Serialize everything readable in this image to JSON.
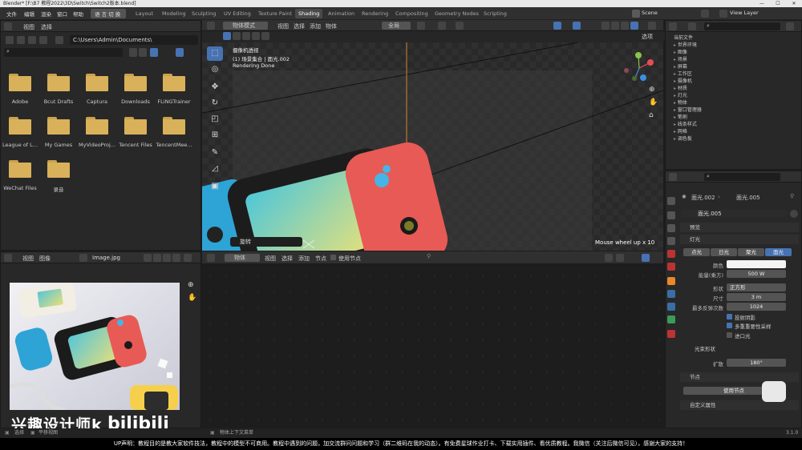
{
  "window": {
    "title": "Blender* [F:\\B7 教程2022\\3D\\Switch\\Switch2版本.blend]"
  },
  "menu": {
    "file": "文件",
    "edit": "编辑",
    "render": "渲染",
    "window": "窗口",
    "help": "帮助",
    "lang": "语 言 切 换"
  },
  "workspaces": [
    "Layout",
    "Modeling",
    "Sculpting",
    "UV Editing",
    "Texture Paint",
    "Shading",
    "Animation",
    "Rendering",
    "Compositing",
    "Geometry Nodes",
    "Scripting"
  ],
  "scene": {
    "label": "Scene",
    "view_layer": "View Layer"
  },
  "filebrowser": {
    "menu_view": "视图",
    "menu_select": "选择",
    "path": "C:\\Users\\Admin\\Documents\\",
    "items": [
      "Adobe",
      "Bcut Drafts",
      "Captura",
      "Downloads",
      "FLiNGTrainer",
      "League of L...",
      "My Games",
      "MyVideoProj...",
      "Tencent Files",
      "TencentMee...",
      "WeChat Files",
      "录音"
    ]
  },
  "viewport": {
    "mode": "物体模式",
    "view": "视图",
    "select": "选择",
    "add": "添加",
    "object": "物体",
    "global": "全局",
    "options": "选项",
    "camera_title": "摄像机透视",
    "collection": "(1) 场景集合 | 面光.002",
    "status": "Rendering Done",
    "rotate_label": "旋转",
    "wheel_msg": "Mouse wheel up x 10"
  },
  "outliner": {
    "search_placeholder": "",
    "current_file": "当前文件",
    "rows": [
      "世界环境",
      "图像",
      "场景",
      "屏幕",
      "工作区",
      "摄像机",
      "材质",
      "灯光",
      "物体",
      "窗口管理器",
      "笔刷",
      "线条样式",
      "网格",
      "调色板"
    ]
  },
  "properties": {
    "breadcrumb_a": "面光.002",
    "breadcrumb_b": "面光.005",
    "light_name": "面光.005",
    "preview": "预览",
    "light": "灯光",
    "types": [
      "点光",
      "日光",
      "聚光",
      "面光"
    ],
    "color_label": "颜色",
    "energy_label": "能量(乘方)",
    "energy": "500 W",
    "shape_label": "形状",
    "shape": "正方形",
    "size_label": "尺寸",
    "size": "3 m",
    "bounces_label": "最多反弹次数",
    "bounces": "1024",
    "cast_shadow": "投射阴影",
    "mis": "多重重要性采样",
    "portal": "进口光",
    "beam_shape": "光束形状",
    "spread_label": "扩散",
    "spread": "180°",
    "nodes": "节点",
    "use_nodes": "使用节点",
    "custom_props": "自定义属性"
  },
  "image_editor": {
    "view": "视图",
    "image_menu": "图像",
    "image_name": "Image.jpg"
  },
  "node_editor": {
    "object": "物体",
    "view": "视图",
    "select": "选择",
    "add": "添加",
    "node": "节点",
    "use_nodes": "使用节点"
  },
  "statusbar": {
    "left1": "选择",
    "left2": "平移视图",
    "mid": "物体上下文菜单",
    "version": "3.1.0"
  },
  "subtitle": "UP声明：教程目的是教大家软件技法，教程中的模型不可商用。教程中遇到的问题，加交流群问问题和学习（群二维码在我的动态）。有免费星球作业打卡、下载实用插件、看优质教程。我微信（关注后微信可见），感谢大家的支持！",
  "watermark": "兴趣设计师k",
  "colors": {
    "accent": "#4772b3",
    "active_tool": "#4772b3",
    "folder": "#d9b15a"
  }
}
